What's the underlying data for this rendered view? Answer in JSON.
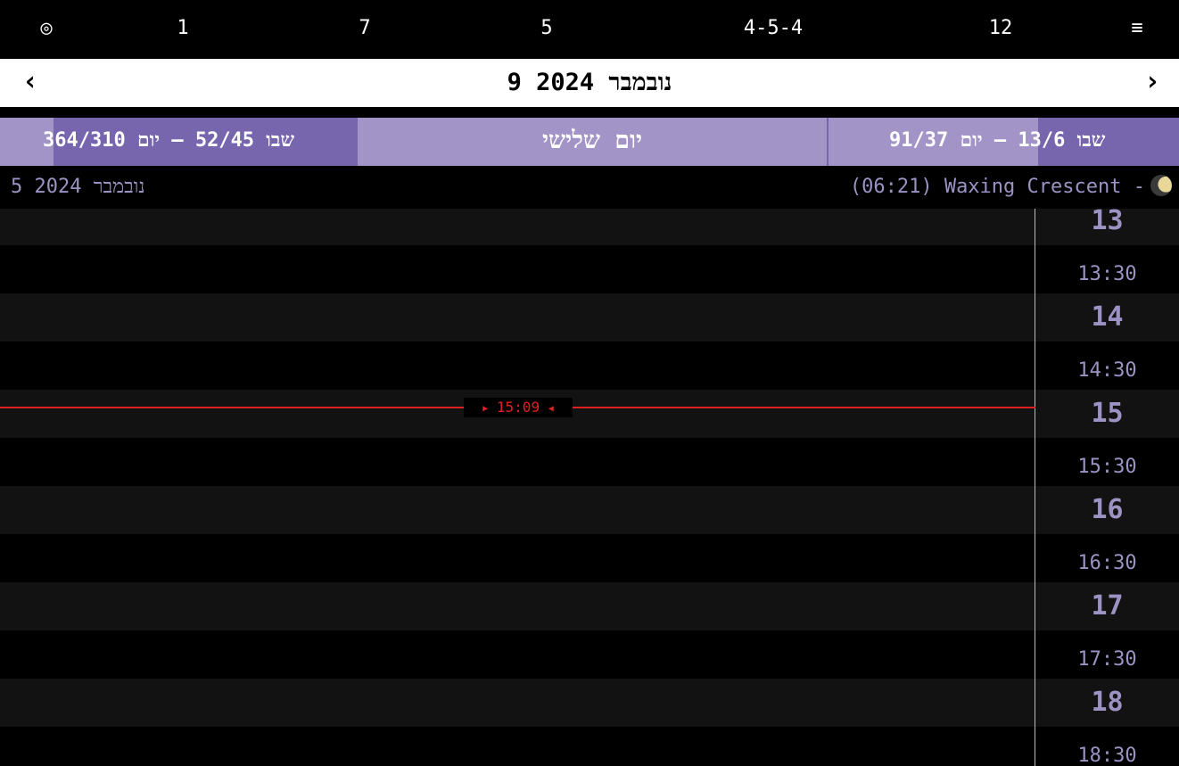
{
  "topbar": {
    "icon": "target-icon",
    "items": [
      "◎",
      "1",
      "7",
      "5",
      "4-5-4",
      "12",
      "≡"
    ]
  },
  "header": {
    "title": "9 נובמבר 2024",
    "prev": "‹",
    "next": "›"
  },
  "week_bar": {
    "left": "שבו 52/45 — יום 364/310",
    "center": "יום שלישי",
    "right": "שבו 13/6 — יום 91/37"
  },
  "info": {
    "date": "5 נובמבר 2024",
    "moon": "(06:21) Waxing Crescent -"
  },
  "timeline": {
    "labels": [
      "13",
      "13:30",
      "14",
      "14:30",
      "15",
      "15:30",
      "16",
      "16:30",
      "17",
      "17:30",
      "18",
      "18:30"
    ],
    "now": "15:09"
  },
  "colors": {
    "accent": "#7766ad",
    "accent_light": "#a294c6",
    "label": "#9d92c4",
    "now_line": "#e02020"
  }
}
